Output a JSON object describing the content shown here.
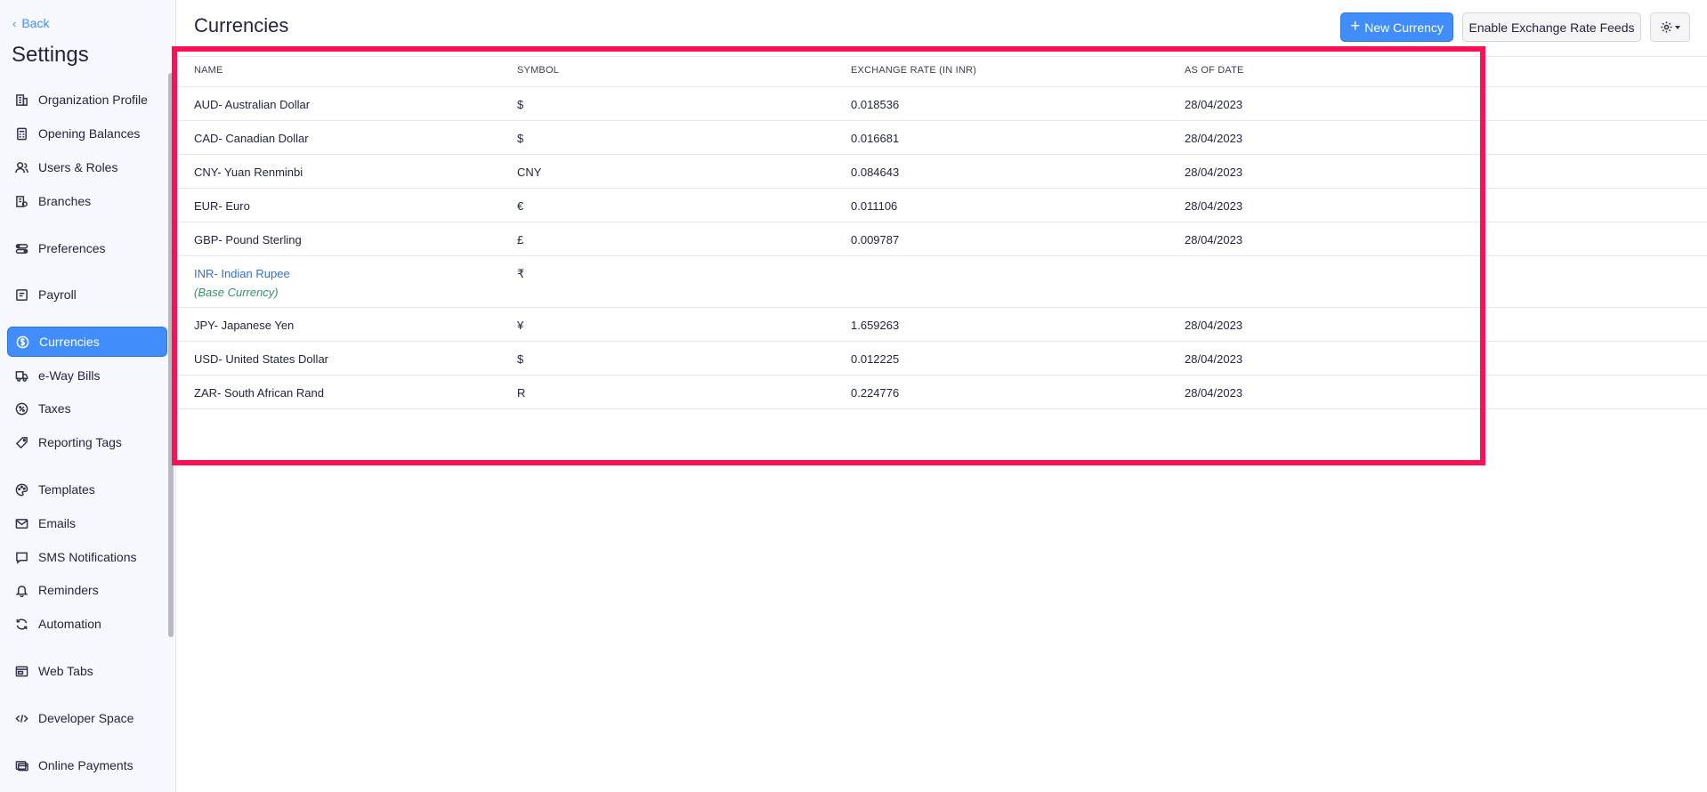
{
  "sidebar": {
    "back_label": "Back",
    "title": "Settings",
    "items": [
      {
        "label": "Organization Profile",
        "icon": "building-icon",
        "active": false
      },
      {
        "label": "Opening Balances",
        "icon": "calculator-icon",
        "active": false
      },
      {
        "label": "Users & Roles",
        "icon": "users-icon",
        "active": false
      },
      {
        "label": "Branches",
        "icon": "branch-icon",
        "active": false
      },
      {
        "label": "Preferences",
        "icon": "preferences-icon",
        "active": false
      },
      {
        "label": "Payroll",
        "icon": "payroll-icon",
        "active": false
      },
      {
        "label": "Currencies",
        "icon": "currency-icon",
        "active": true
      },
      {
        "label": "e-Way Bills",
        "icon": "truck-icon",
        "active": false
      },
      {
        "label": "Taxes",
        "icon": "percent-icon",
        "active": false
      },
      {
        "label": "Reporting Tags",
        "icon": "tag-icon",
        "active": false
      },
      {
        "label": "Templates",
        "icon": "palette-icon",
        "active": false
      },
      {
        "label": "Emails",
        "icon": "mail-icon",
        "active": false
      },
      {
        "label": "SMS Notifications",
        "icon": "sms-icon",
        "active": false
      },
      {
        "label": "Reminders",
        "icon": "bell-icon",
        "active": false
      },
      {
        "label": "Automation",
        "icon": "refresh-icon",
        "active": false
      },
      {
        "label": "Web Tabs",
        "icon": "window-icon",
        "active": false
      },
      {
        "label": "Developer Space",
        "icon": "code-icon",
        "active": false
      },
      {
        "label": "Online Payments",
        "icon": "payment-icon",
        "active": false
      }
    ]
  },
  "header": {
    "title": "Currencies",
    "new_currency_label": "New Currency",
    "enable_feeds_label": "Enable Exchange Rate Feeds",
    "gear_icon": "gear-icon"
  },
  "table": {
    "columns": [
      "NAME",
      "SYMBOL",
      "EXCHANGE RATE (IN INR)",
      "AS OF DATE"
    ],
    "rows": [
      {
        "name": "AUD- Australian Dollar",
        "symbol": "$",
        "rate": "0.018536",
        "date": "28/04/2023"
      },
      {
        "name": "CAD- Canadian Dollar",
        "symbol": "$",
        "rate": "0.016681",
        "date": "28/04/2023"
      },
      {
        "name": "CNY- Yuan Renminbi",
        "symbol": "CNY",
        "rate": "0.084643",
        "date": "28/04/2023"
      },
      {
        "name": "EUR- Euro",
        "symbol": "€",
        "rate": "0.011106",
        "date": "28/04/2023"
      },
      {
        "name": "GBP- Pound Sterling",
        "symbol": "£",
        "rate": "0.009787",
        "date": "28/04/2023"
      },
      {
        "name": "INR- Indian Rupee",
        "symbol": "₹",
        "rate": "",
        "date": "",
        "note": "(Base Currency)"
      },
      {
        "name": "JPY- Japanese Yen",
        "symbol": "¥",
        "rate": "1.659263",
        "date": "28/04/2023"
      },
      {
        "name": "USD- United States Dollar",
        "symbol": "$",
        "rate": "0.012225",
        "date": "28/04/2023"
      },
      {
        "name": "ZAR- South African Rand",
        "symbol": "R",
        "rate": "0.224776",
        "date": "28/04/2023"
      }
    ]
  },
  "colors": {
    "accent": "#408dfb",
    "link": "#3a6fc5",
    "highlight": "#ff0f54",
    "base_note": "#398d6a"
  }
}
